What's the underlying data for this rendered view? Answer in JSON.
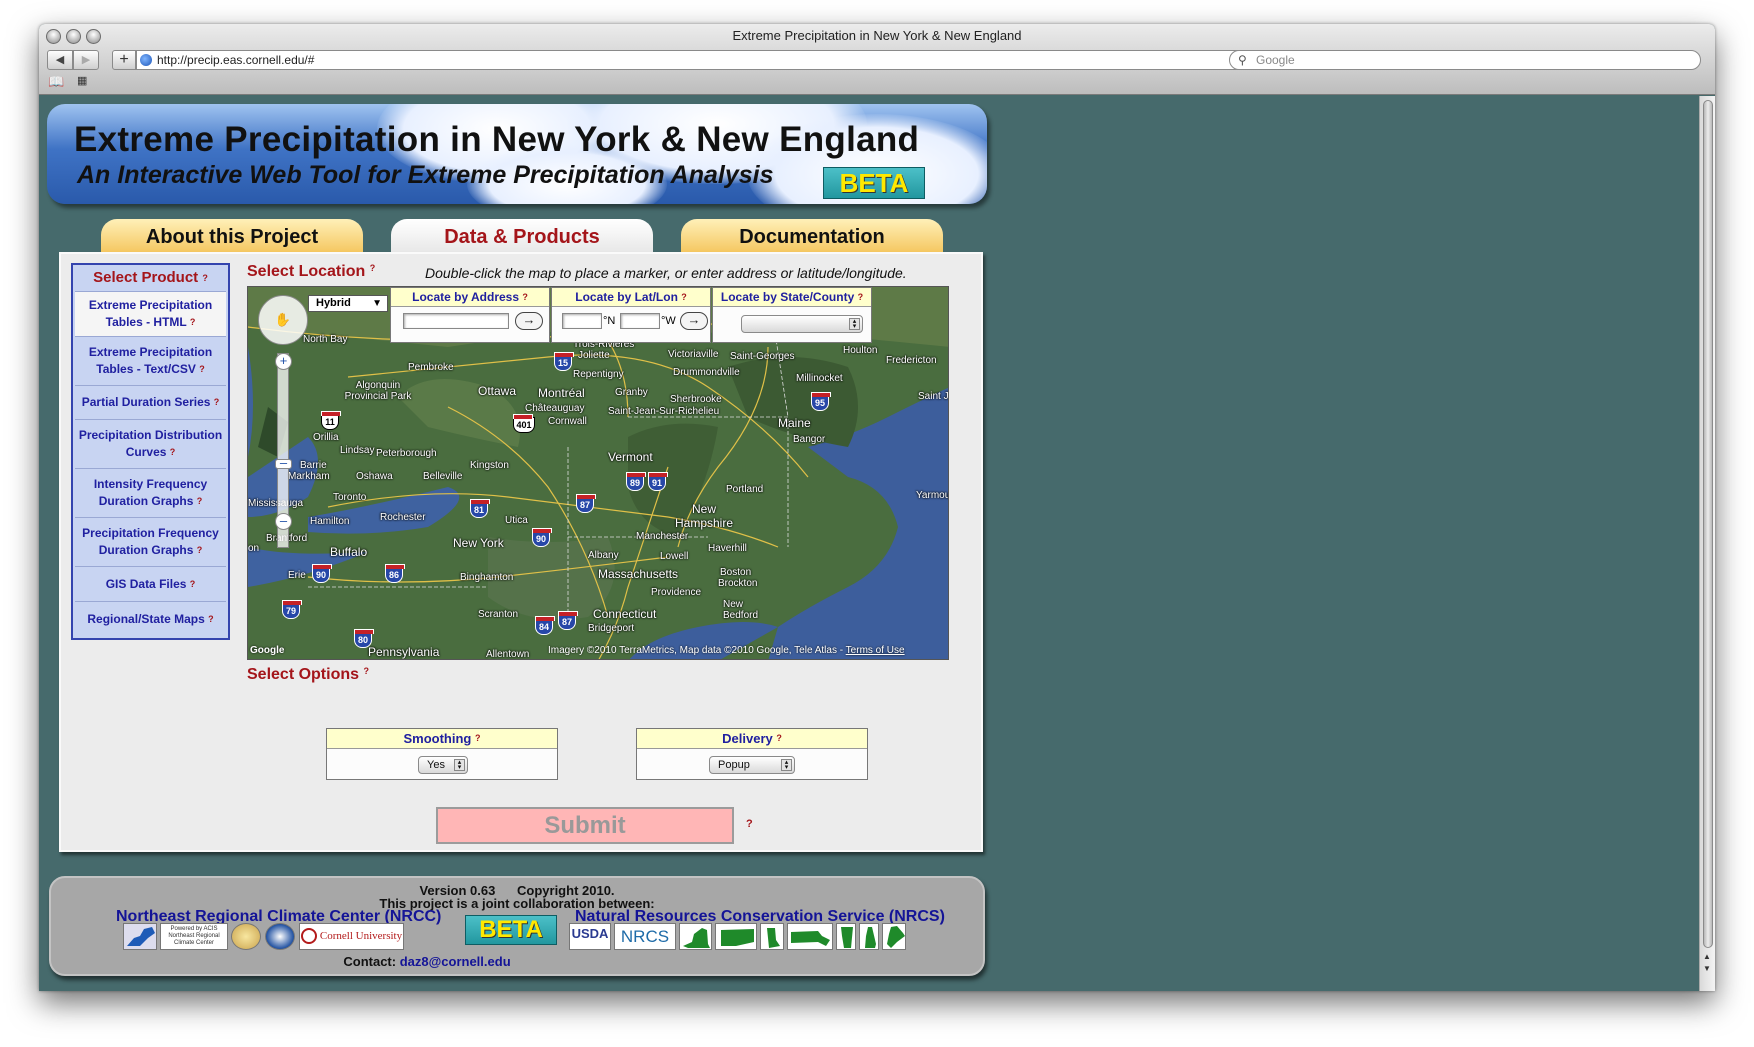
{
  "browser": {
    "window_title": "Extreme Precipitation in New York & New England",
    "url": "http://precip.eas.cornell.edu/#",
    "search_placeholder": "Google"
  },
  "site": {
    "title": "Extreme Precipitation in New York & New England",
    "subtitle": "An Interactive Web Tool for Extreme Precipitation Analysis",
    "beta_label": "BETA",
    "tabs": [
      {
        "label": "About this Project",
        "active": false
      },
      {
        "label": "Data & Products",
        "active": true
      },
      {
        "label": "Documentation",
        "active": false
      }
    ]
  },
  "sidebar": {
    "heading": "Select Product",
    "help_mark": "?",
    "items": [
      {
        "label": "Extreme Precipitation Tables - HTML",
        "selected": true
      },
      {
        "label": "Extreme Precipitation Tables - Text/CSV",
        "selected": false
      },
      {
        "label": "Partial Duration Series",
        "selected": false
      },
      {
        "label": "Precipitation Distribution Curves",
        "selected": false
      },
      {
        "label": "Intensity Frequency Duration Graphs",
        "selected": false
      },
      {
        "label": "Precipitation Frequency Duration Graphs",
        "selected": false
      },
      {
        "label": "GIS Data Files",
        "selected": false
      },
      {
        "label": "Regional/State Maps",
        "selected": false
      }
    ]
  },
  "location": {
    "heading": "Select Location",
    "hint": "Double-click the map to place a marker, or enter address or latitude/longitude.",
    "by_address": {
      "label": "Locate by Address",
      "value": ""
    },
    "by_latlon": {
      "label": "Locate by Lat/Lon",
      "lat_unit": "°N",
      "lon_unit": "°W"
    },
    "by_state": {
      "label": "Locate by State/County",
      "value": ""
    },
    "go_symbol": "→"
  },
  "map": {
    "map_type": "Hybrid",
    "credits": "Imagery ©2010 TerraMetrics, Map data ©2010 Google, Tele Atlas - ",
    "terms": "Terms of Use",
    "google_mark": "Google",
    "labels": {
      "trois_rivieres": "Trois-Rivières",
      "joliette": "Joliette",
      "victoriaville": "Victoriaville",
      "saint_georges": "Saint-Georges",
      "houlton": "Houlton",
      "fredericton": "Fredericton",
      "north_bay": "North Bay",
      "pembroke": "Pembroke",
      "repentigny": "Repentigny",
      "drummondville": "Drummondville",
      "millinocket": "Millinocket",
      "algonquin": "Algonquin Provincial Park",
      "ottawa": "Ottawa",
      "montreal": "Montréal",
      "granby": "Granby",
      "sherbrooke": "Sherbrooke",
      "chateauguay": "Châteauguay",
      "saint_jean": "Saint-Jean-Sur-Richelieu",
      "cornwall": "Cornwall",
      "maine": "Maine",
      "bangor": "Bangor",
      "saint_john": "Saint Jo",
      "orillia": "Orillia",
      "lindsay": "Lindsay",
      "peterborough": "Peterborough",
      "kingston": "Kingston",
      "vermont": "Vermont",
      "barrie": "Barrie",
      "markham": "Markham",
      "oshawa": "Oshawa",
      "belleville": "Belleville",
      "portland": "Portland",
      "mississauga": "Mississauga",
      "toronto": "Toronto",
      "new_hampshire": "New Hampshire",
      "yarmouth": "Yarmout",
      "hamilton": "Hamilton",
      "rochester": "Rochester",
      "utica": "Utica",
      "brantford": "Brantford",
      "manchester": "Manchester",
      "new_york": "New York",
      "buffalo": "Buffalo",
      "haverhill": "Haverhill",
      "albany": "Albany",
      "lowell": "Lowell",
      "on": "on",
      "erie": "Erie",
      "massachusetts": "Massachusetts",
      "boston": "Boston",
      "binghamton": "Binghamton",
      "providence": "Providence",
      "brockton": "Brockton",
      "scranton": "Scranton",
      "connecticut": "Connecticut",
      "new_bedford": "New Bedford",
      "bridgeport": "Bridgeport",
      "pennsylvania": "Pennsylvania",
      "allentown": "Allentown"
    },
    "shields": {
      "s15": "15",
      "s11": "11",
      "s401": "401",
      "s95": "95",
      "s89": "89",
      "s91": "91",
      "s81": "81",
      "s87": "87",
      "s90a": "90",
      "s90b": "90",
      "s86": "86",
      "s79": "79",
      "s84": "84",
      "s87b": "87",
      "s80": "80"
    }
  },
  "options": {
    "heading": "Select Options",
    "smoothing": {
      "label": "Smoothing",
      "value": "Yes"
    },
    "delivery": {
      "label": "Delivery",
      "value": "Popup"
    }
  },
  "submit": {
    "label": "Submit",
    "help_mark": "?"
  },
  "footer": {
    "version": "Version 0.63",
    "copyright": "Copyright 2010.",
    "collab": "This project is a joint collaboration between:",
    "nrcc": "Northeast Regional Climate Center (NRCC)",
    "nrcs": "Natural Resources Conservation Service (NRCS)",
    "contact_label": "Contact:",
    "contact_email": "daz8@cornell.edu",
    "beta_label": "BETA",
    "logos": {
      "acis": "Powered by ACIS Northeast Regional Climate Center",
      "cornell": "Cornell University",
      "usda": "USDA",
      "nrcs": "NRCS"
    }
  },
  "colors": {
    "accent_red": "#a4151a",
    "link_blue": "#141497",
    "page_bg": "#466a6c",
    "tab_yellow": "#f4c45a"
  }
}
